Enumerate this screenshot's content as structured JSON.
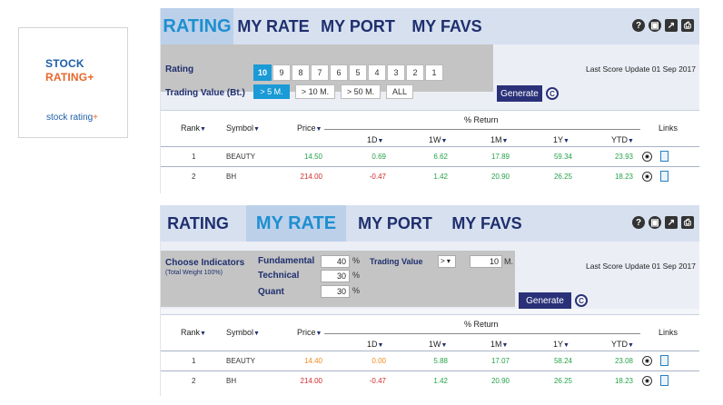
{
  "logo": {
    "line1": "STOCK",
    "line2": "RATING",
    "line2_plus": "+",
    "sub": "stock rating",
    "sub_plus": "+"
  },
  "tabs": [
    "RATING",
    "MY RATE",
    "MY PORT",
    "MY FAVS"
  ],
  "tool_icons": [
    "help-icon",
    "book-icon",
    "share-icon",
    "print-icon"
  ],
  "panel1": {
    "active_tab": "RATING",
    "rating_label": "Rating",
    "trading_label": "Trading Value (Bt.)",
    "rating_buttons": [
      "10",
      "9",
      "8",
      "7",
      "6",
      "5",
      "4",
      "3",
      "2",
      "1"
    ],
    "rating_selected": "10",
    "trading_buttons": [
      "> 5 M.",
      "> 10 M.",
      "> 50 M.",
      "ALL"
    ],
    "trading_selected": "> 5 M.",
    "generate": "Generate",
    "c_icon": "C",
    "update": "Last Score Update 01 Sep 2017"
  },
  "panel2": {
    "active_tab": "MY RATE",
    "choose_label": "Choose Indicators",
    "choose_sub": "(Total Weight 100%)",
    "fundamental_label": "Fundamental",
    "fundamental_value": "40",
    "technical_label": "Technical",
    "technical_value": "30",
    "quant_label": "Quant",
    "quant_value": "30",
    "pct_sign": "%",
    "trading_value_label": "Trading Value",
    "trading_op": ">",
    "trading_amount": "10",
    "trading_unit": "M.",
    "generate": "Generate",
    "c_icon": "C",
    "update": "Last Score Update 01 Sep 2017"
  },
  "table_headers": {
    "rank": "Rank",
    "symbol": "Symbol",
    "price": "Price",
    "return": "% Return",
    "d1": "1D",
    "w1": "1W",
    "m1": "1M",
    "y1": "1Y",
    "ytd": "YTD",
    "links": "Links",
    "sort_arrow": "▼"
  },
  "table1": [
    {
      "rank": "1",
      "symbol": "BEAUTY",
      "price": "14.50",
      "d1": "0.69",
      "w1": "6.62",
      "m1": "17.89",
      "y1": "59.34",
      "ytd": "23.93"
    },
    {
      "rank": "2",
      "symbol": "BH",
      "price": "214.00",
      "d1": "-0.47",
      "w1": "1.42",
      "m1": "20.90",
      "y1": "26.25",
      "ytd": "18.23"
    }
  ],
  "table2": [
    {
      "rank": "1",
      "symbol": "BEAUTY",
      "price": "14.40",
      "d1": "0.00",
      "w1": "5.88",
      "m1": "17.07",
      "y1": "58.24",
      "ytd": "23.08"
    },
    {
      "rank": "2",
      "symbol": "BH",
      "price": "214.00",
      "d1": "-0.47",
      "w1": "1.42",
      "m1": "20.90",
      "y1": "26.25",
      "ytd": "18.23"
    }
  ],
  "colors": {
    "positive": "#25a248",
    "negative": "#d02c2c",
    "unchanged": "#f08a1a",
    "accent": "#1a9ad6",
    "navy": "#2a3178"
  }
}
